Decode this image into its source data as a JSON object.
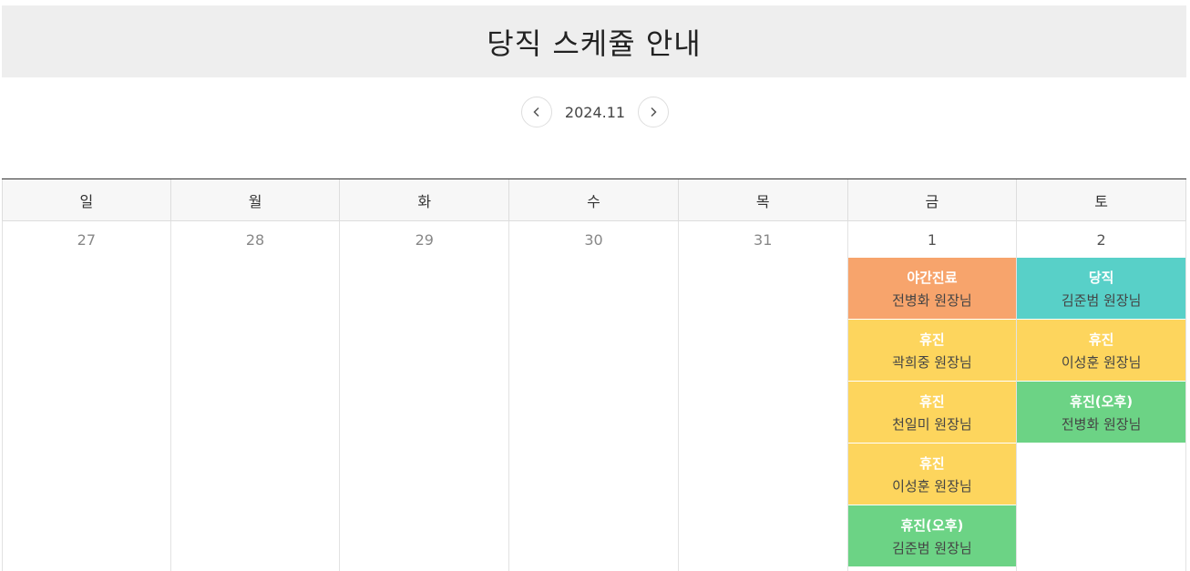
{
  "page": {
    "title": "당직 스케쥴 안내"
  },
  "nav": {
    "month": "2024.11",
    "prev_icon": "chevron-left-icon",
    "next_icon": "chevron-right-icon"
  },
  "colors": {
    "night_clinic": "#f7a46c",
    "duty": "#58d0c8",
    "closed": "#fdd55d",
    "closed_pm": "#6cd385"
  },
  "weekdays": [
    "일",
    "월",
    "화",
    "수",
    "목",
    "금",
    "토"
  ],
  "days": [
    {
      "num": "27",
      "events": []
    },
    {
      "num": "28",
      "events": []
    },
    {
      "num": "29",
      "events": []
    },
    {
      "num": "30",
      "events": []
    },
    {
      "num": "31",
      "events": []
    },
    {
      "num": "1",
      "events": [
        {
          "type": "야간진료",
          "doctor": "전병화 원장님"
        },
        {
          "type": "휴진",
          "doctor": "곽희중 원장님"
        },
        {
          "type": "휴진",
          "doctor": "천일미 원장님"
        },
        {
          "type": "휴진",
          "doctor": "이성훈 원장님"
        },
        {
          "type": "휴진(오후)",
          "doctor": "김준범 원장님"
        }
      ]
    },
    {
      "num": "2",
      "events": [
        {
          "type": "당직",
          "doctor": "김준범 원장님"
        },
        {
          "type": "휴진",
          "doctor": "이성훈 원장님"
        },
        {
          "type": "휴진(오후)",
          "doctor": "전병화 원장님"
        }
      ]
    }
  ]
}
